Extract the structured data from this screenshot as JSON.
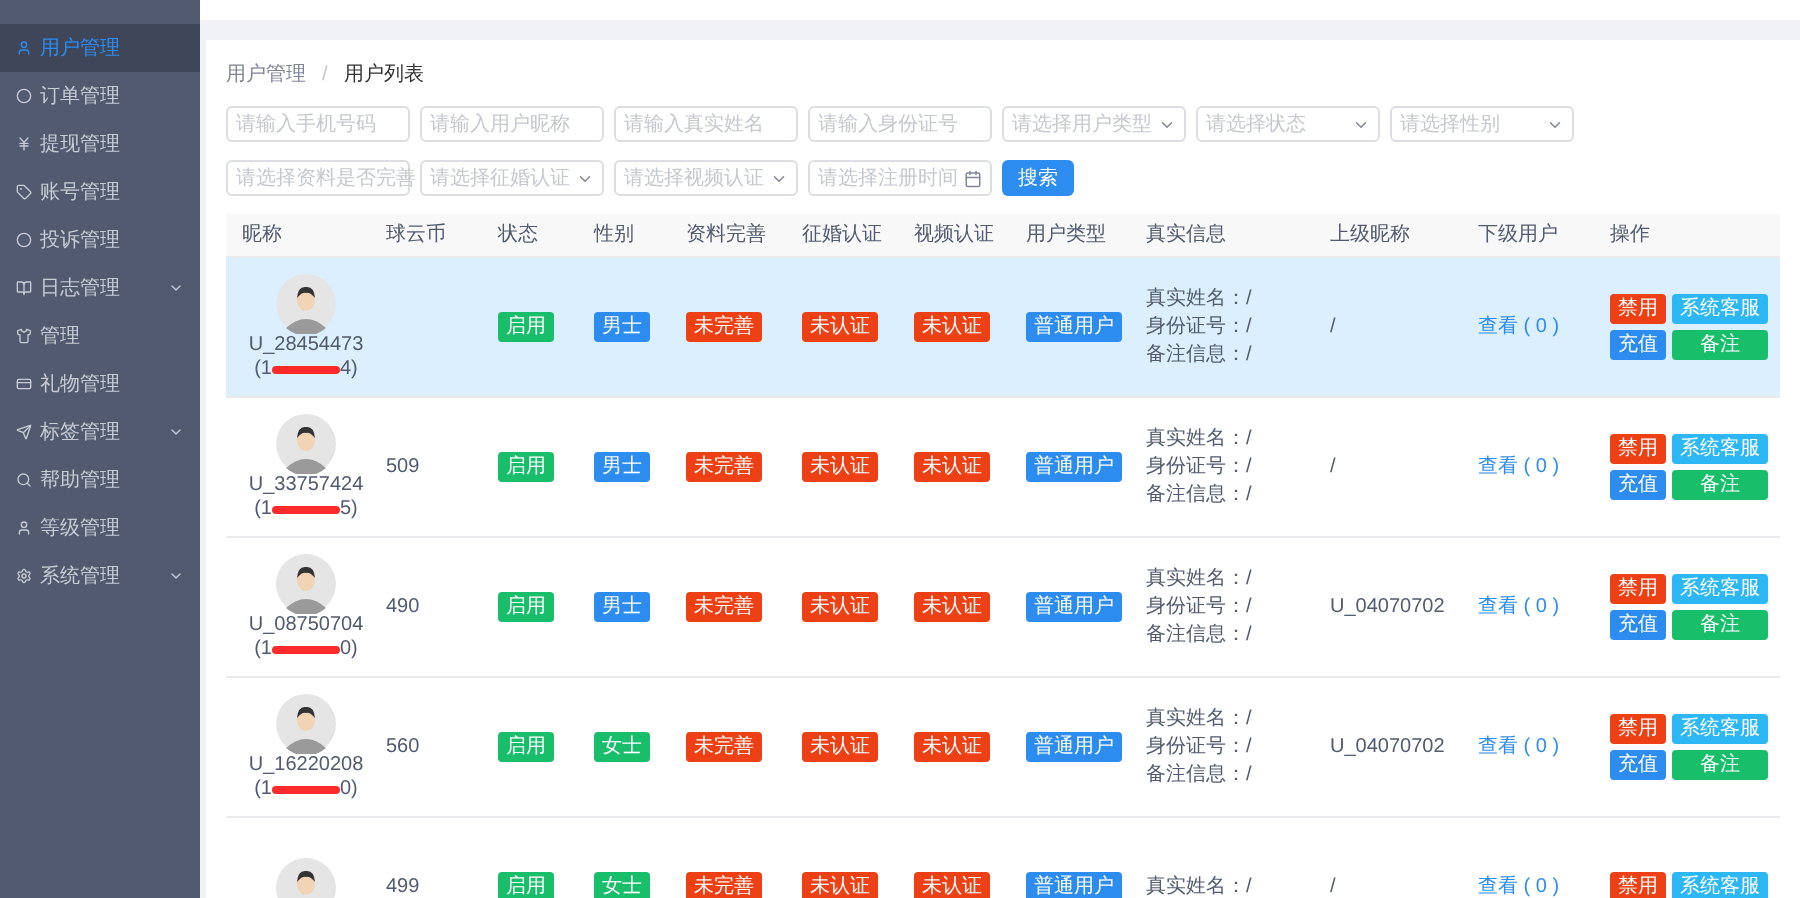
{
  "sidebar": {
    "items": [
      {
        "label": "用户管理",
        "selected": true,
        "expandable": false
      },
      {
        "label": "订单管理",
        "selected": false,
        "expandable": false
      },
      {
        "label": "提现管理",
        "selected": false,
        "expandable": false
      },
      {
        "label": "账号管理",
        "selected": false,
        "expandable": false
      },
      {
        "label": "投诉管理",
        "selected": false,
        "expandable": false
      },
      {
        "label": "日志管理",
        "selected": false,
        "expandable": true
      },
      {
        "label": "管理",
        "selected": false,
        "expandable": false
      },
      {
        "label": "礼物管理",
        "selected": false,
        "expandable": false
      },
      {
        "label": "标签管理",
        "selected": false,
        "expandable": true
      },
      {
        "label": "帮助管理",
        "selected": false,
        "expandable": false
      },
      {
        "label": "等级管理",
        "selected": false,
        "expandable": false
      },
      {
        "label": "系统管理",
        "selected": false,
        "expandable": true
      }
    ]
  },
  "breadcrumb": {
    "parent": "用户管理",
    "separator": "/",
    "current": "用户列表"
  },
  "filters": [
    [
      {
        "kind": "text",
        "placeholder": "请输入手机号码"
      },
      {
        "kind": "text",
        "placeholder": "请输入用户昵称"
      },
      {
        "kind": "text",
        "placeholder": "请输入真实姓名"
      },
      {
        "kind": "text",
        "placeholder": "请输入身份证号"
      },
      {
        "kind": "select",
        "placeholder": "请选择用户类型"
      },
      {
        "kind": "select",
        "placeholder": "请选择状态"
      },
      {
        "kind": "select",
        "placeholder": "请选择性别"
      }
    ],
    [
      {
        "kind": "select",
        "placeholder": "请选择资料是否完善"
      },
      {
        "kind": "select",
        "placeholder": "请选择征婚认证"
      },
      {
        "kind": "select",
        "placeholder": "请选择视频认证"
      },
      {
        "kind": "date",
        "placeholder": "请选择注册时间"
      },
      {
        "kind": "button",
        "label": "搜索"
      }
    ]
  ],
  "table": {
    "columns": [
      "昵称",
      "球云币",
      "状态",
      "性别",
      "资料完善",
      "征婚认证",
      "视频认证",
      "用户类型",
      "真实信息",
      "上级昵称",
      "下级用户",
      "操作"
    ],
    "rows": [
      {
        "selected": true,
        "nickname": "U_28454473",
        "phone_prefix": "(1",
        "phone_suffix": "4)",
        "status": {
          "label": "启用",
          "color": "#19be6b"
        },
        "gender": {
          "label": "男士",
          "color": "#2d8cf0"
        },
        "profile": "未完善",
        "marriage_auth": "未认证",
        "video_auth": "未认证",
        "user_type": "普通用户",
        "real_info": [
          "真实姓名：/",
          "身份证号：/",
          "备注信息：/"
        ],
        "parent": "/",
        "children_link": "查看 ( 0 )",
        "actions": [
          {
            "label": "禁用",
            "color": "#ed4014"
          },
          {
            "label": "系统客服",
            "color": "#2db7f5"
          },
          {
            "label": "充值",
            "color": "#2d8cf0"
          },
          {
            "label": "备注",
            "color": "#19be6b"
          }
        ]
      },
      {
        "selected": false,
        "nickname": "U_33757424",
        "phone_prefix": "(1",
        "phone_suffix": "5)",
        "coins": "509",
        "status": {
          "label": "启用",
          "color": "#19be6b"
        },
        "gender": {
          "label": "男士",
          "color": "#2d8cf0"
        },
        "profile": "未完善",
        "marriage_auth": "未认证",
        "video_auth": "未认证",
        "user_type": "普通用户",
        "real_info": [
          "真实姓名：/",
          "身份证号：/",
          "备注信息：/"
        ],
        "parent": "/",
        "children_link": "查看 ( 0 )",
        "actions": [
          {
            "label": "禁用",
            "color": "#ed4014"
          },
          {
            "label": "系统客服",
            "color": "#2db7f5"
          },
          {
            "label": "充值",
            "color": "#2d8cf0"
          },
          {
            "label": "备注",
            "color": "#19be6b"
          }
        ]
      },
      {
        "selected": false,
        "nickname": "U_08750704",
        "phone_prefix": "(1",
        "phone_suffix": "0)",
        "coins": "490",
        "status": {
          "label": "启用",
          "color": "#19be6b"
        },
        "gender": {
          "label": "男士",
          "color": "#2d8cf0"
        },
        "profile": "未完善",
        "marriage_auth": "未认证",
        "video_auth": "未认证",
        "user_type": "普通用户",
        "real_info": [
          "真实姓名：/",
          "身份证号：/",
          "备注信息：/"
        ],
        "parent": "U_04070702",
        "children_link": "查看 ( 0 )",
        "actions": [
          {
            "label": "禁用",
            "color": "#ed4014"
          },
          {
            "label": "系统客服",
            "color": "#2db7f5"
          },
          {
            "label": "充值",
            "color": "#2d8cf0"
          },
          {
            "label": "备注",
            "color": "#19be6b"
          }
        ]
      },
      {
        "selected": false,
        "nickname": "U_16220208",
        "phone_prefix": "(1",
        "phone_suffix": "0)",
        "coins": "560",
        "status": {
          "label": "启用",
          "color": "#19be6b"
        },
        "gender": {
          "label": "女士",
          "color": "#19be6b"
        },
        "profile": "未完善",
        "marriage_auth": "未认证",
        "video_auth": "未认证",
        "user_type": "普通用户",
        "real_info": [
          "真实姓名：/",
          "身份证号：/",
          "备注信息：/"
        ],
        "parent": "U_04070702",
        "children_link": "查看 ( 0 )",
        "actions": [
          {
            "label": "禁用",
            "color": "#ed4014"
          },
          {
            "label": "系统客服",
            "color": "#2db7f5"
          },
          {
            "label": "充值",
            "color": "#2d8cf0"
          },
          {
            "label": "备注",
            "color": "#19be6b"
          }
        ]
      },
      {
        "selected": false,
        "coins": "499",
        "status": {
          "label": "启用",
          "color": "#19be6b"
        },
        "gender": {
          "label": "女士",
          "color": "#19be6b"
        },
        "profile": "未完善",
        "marriage_auth": "未认证",
        "video_auth": "未认证",
        "user_type": "普通用户",
        "real_info": [
          "真实姓名：/"
        ],
        "parent": "/",
        "children_link": "查看 ( 0 )",
        "actions": [
          {
            "label": "禁用",
            "color": "#ed4014"
          },
          {
            "label": "系统客服",
            "color": "#2db7f5"
          }
        ]
      }
    ]
  }
}
